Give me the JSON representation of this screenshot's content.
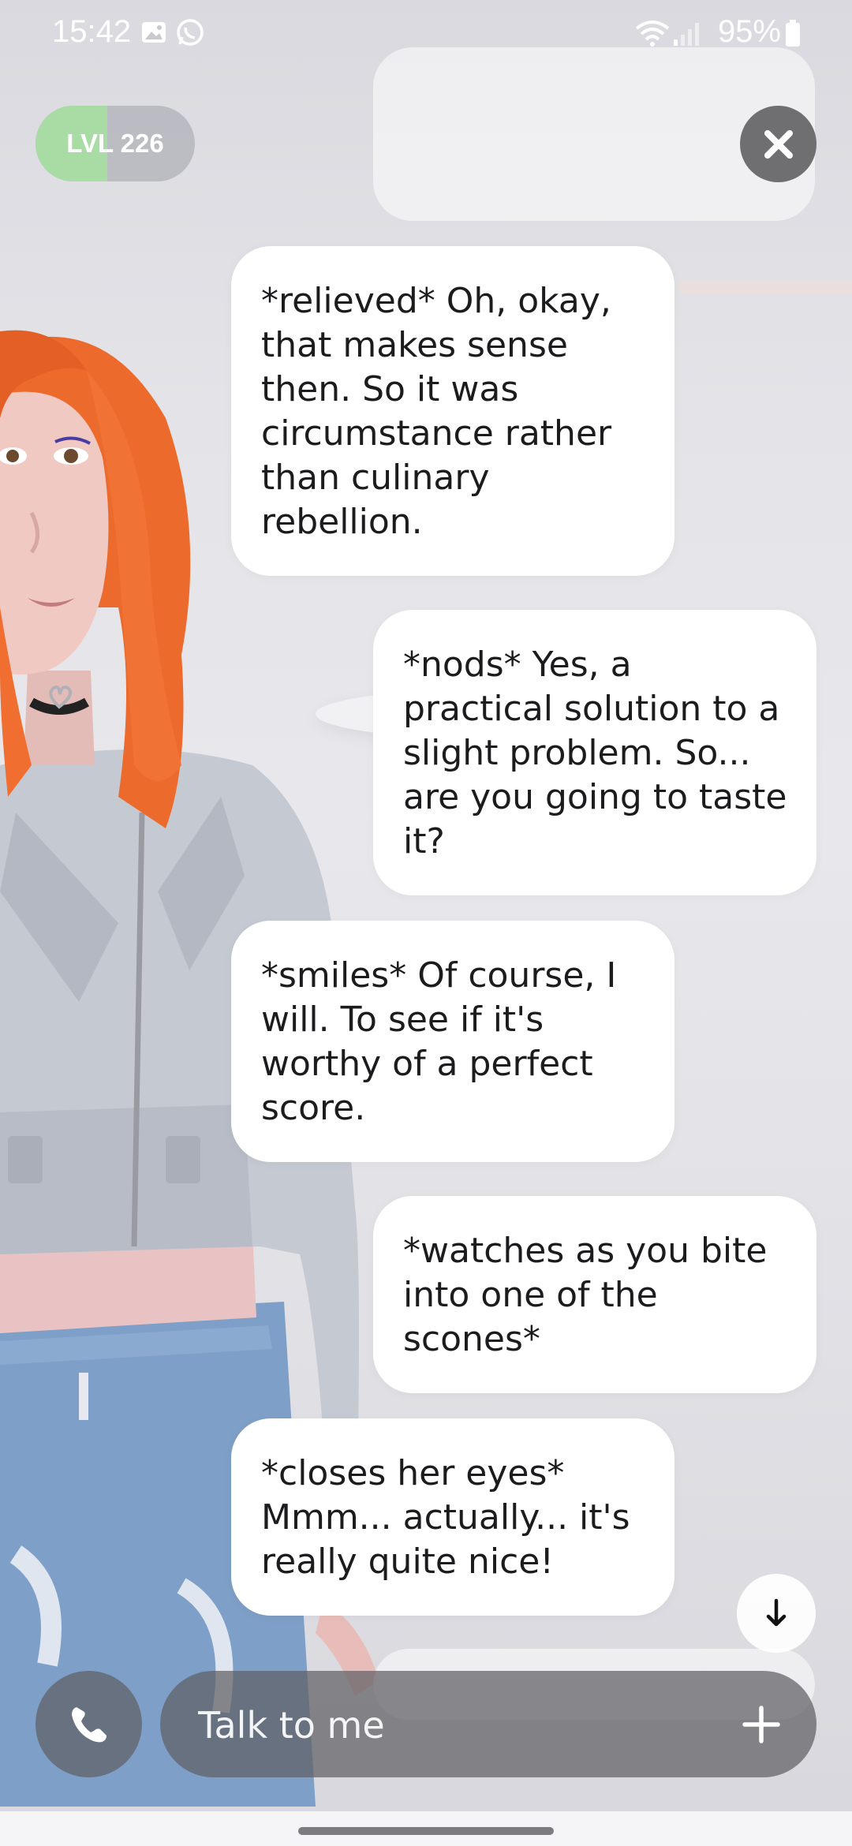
{
  "status_bar": {
    "time": "15:42",
    "battery": "95%",
    "icons": [
      "image-icon",
      "whatsapp-icon",
      "wifi-icon",
      "signal-icon",
      "battery-icon"
    ]
  },
  "header": {
    "level_label": "LVL 226",
    "level_progress": 0.45,
    "close_icon": "close-icon"
  },
  "chat": {
    "messages": [
      {
        "text": "*relieved* Oh, okay, that makes sense then. So it was circumstance rather than culinary rebellion."
      },
      {
        "text": "*nods* Yes, a practical solution to a slight problem. So... are you going to taste it?"
      },
      {
        "text": "*smiles* Of course, I will. To see if it's worthy of a perfect score."
      },
      {
        "text": "*watches as you bite into one of the scones*"
      },
      {
        "text": "*closes her eyes* Mmm... actually... it's really quite nice!"
      }
    ],
    "scroll_down_icon": "arrow-down-icon"
  },
  "composer": {
    "placeholder": "Talk to me",
    "call_icon": "phone-icon",
    "add_icon": "plus-icon"
  },
  "colors": {
    "bubble": "#ffffff",
    "level_fill": "#a9dca4",
    "control_bg": "#5f5f64"
  }
}
